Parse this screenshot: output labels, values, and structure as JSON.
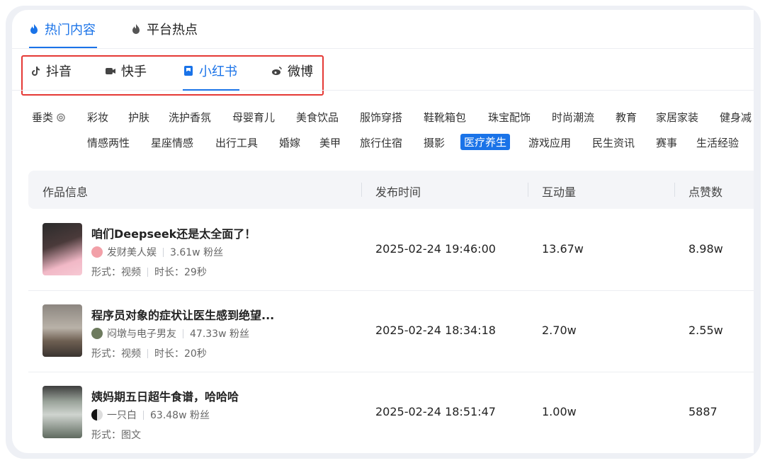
{
  "main_tabs": [
    {
      "label": "热门内容",
      "active": true
    },
    {
      "label": "平台热点",
      "active": false
    }
  ],
  "platforms": [
    {
      "label": "抖音",
      "icon": "douyin-icon"
    },
    {
      "label": "快手",
      "icon": "kuaishou-icon"
    },
    {
      "label": "小红书",
      "icon": "xiaohongshu-icon",
      "active": true
    },
    {
      "label": "微博",
      "icon": "weibo-icon"
    }
  ],
  "category_label": "垂类",
  "categories_row1": [
    "彩妆",
    "护肤",
    "洗护香氛",
    "母婴育儿",
    "美食饮品",
    "服饰穿搭",
    "鞋靴箱包",
    "珠宝配饰",
    "时尚潮流",
    "教育",
    "家居家装",
    "健身减"
  ],
  "categories_row2": [
    "情感两性",
    "星座情感",
    "出行工具",
    "婚嫁",
    "美甲",
    "旅行住宿",
    "摄影",
    "医疗养生",
    "游戏应用",
    "民生资讯",
    "赛事",
    "生活经验"
  ],
  "active_category": "医疗养生",
  "table": {
    "headers": [
      "作品信息",
      "发布时间",
      "互动量",
      "点赞数"
    ],
    "rows": [
      {
        "title": "咱们Deepseek还是太全面了！",
        "author": "发财美人娱",
        "fans": "3.61w 粉丝",
        "form": "形式：视频",
        "duration": "时长：29秒",
        "time": "2025-02-24 19:46:00",
        "interactions": "13.67w",
        "likes": "8.98w"
      },
      {
        "title": "程序员对象的症状让医生感到绝望...",
        "author": "闷墩与电子男友",
        "fans": "47.33w 粉丝",
        "form": "形式：视频",
        "duration": "时长：20秒",
        "time": "2025-02-24 18:34:18",
        "interactions": "2.70w",
        "likes": "2.55w"
      },
      {
        "title": "姨妈期五日超牛食谱，哈哈哈",
        "author": "一只白",
        "fans": "63.48w 粉丝",
        "form": "形式：图文",
        "duration": "",
        "time": "2025-02-24 18:51:47",
        "interactions": "1.00w",
        "likes": "5887"
      }
    ]
  },
  "colors": {
    "accent": "#1a73e8",
    "highlight_border": "#e53935"
  }
}
